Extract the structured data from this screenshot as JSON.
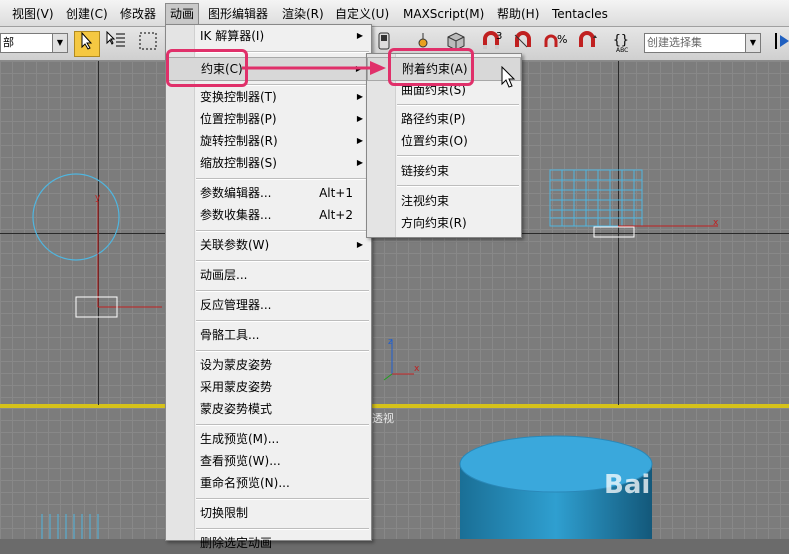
{
  "menubar": {
    "items": [
      "视图(V)",
      "创建(C)",
      "修改器",
      "动画",
      "图形编辑器",
      "渲染(R)",
      "自定义(U)",
      "MAXScript(M)",
      "帮助(H)",
      "Tentacles"
    ]
  },
  "toolbar": {
    "left_combo": "部",
    "selection_set_placeholder": "创建选择集",
    "icons": [
      "select-arrow-icon",
      "select-by-name-icon",
      "select-region-icon",
      "named-selection-icon",
      "snap-3d-icon",
      "angle-snap-icon",
      "percent-snap-icon",
      "spinner-snap-icon",
      "edit-named-sets-icon",
      "mirror-icon"
    ],
    "snap_label": "3"
  },
  "animation_menu": {
    "items": [
      {
        "label": "IK 解算器(I)",
        "submenu": true
      },
      {
        "label": "约束(C)",
        "submenu": true
      },
      {
        "label": "变换控制器(T)",
        "submenu": true
      },
      {
        "label": "位置控制器(P)",
        "submenu": true
      },
      {
        "label": "旋转控制器(R)",
        "submenu": true
      },
      {
        "label": "缩放控制器(S)",
        "submenu": true
      },
      {
        "label": "参数编辑器...",
        "shortcut": "Alt+1"
      },
      {
        "label": "参数收集器...",
        "shortcut": "Alt+2"
      },
      {
        "label": "关联参数(W)",
        "submenu": true
      },
      {
        "label": "动画层..."
      },
      {
        "label": "反应管理器..."
      },
      {
        "label": "骨骼工具..."
      },
      {
        "label": "设为蒙皮姿势"
      },
      {
        "label": "采用蒙皮姿势"
      },
      {
        "label": "蒙皮姿势模式"
      },
      {
        "label": "生成预览(M)..."
      },
      {
        "label": "查看预览(W)..."
      },
      {
        "label": "重命名预览(N)..."
      },
      {
        "label": "切换限制"
      },
      {
        "label": "删除选定动画"
      }
    ]
  },
  "constraint_submenu": {
    "items": [
      "附着约束(A)",
      "曲面约束(S)",
      "路径约束(P)",
      "位置约束(O)",
      "链接约束",
      "注视约束",
      "方向约束(R)"
    ]
  },
  "viewports": {
    "perspective_label": "透视",
    "axis_x": "x",
    "axis_y": "y",
    "axis_z": "z"
  },
  "watermark": "Bai",
  "colors": {
    "highlight": "#e0306a",
    "selected_menu_item": "#d8d8d8",
    "object_wire": "#4fb6e0",
    "cylinder": "#2f9fd0",
    "axis_red": "#d02020"
  }
}
